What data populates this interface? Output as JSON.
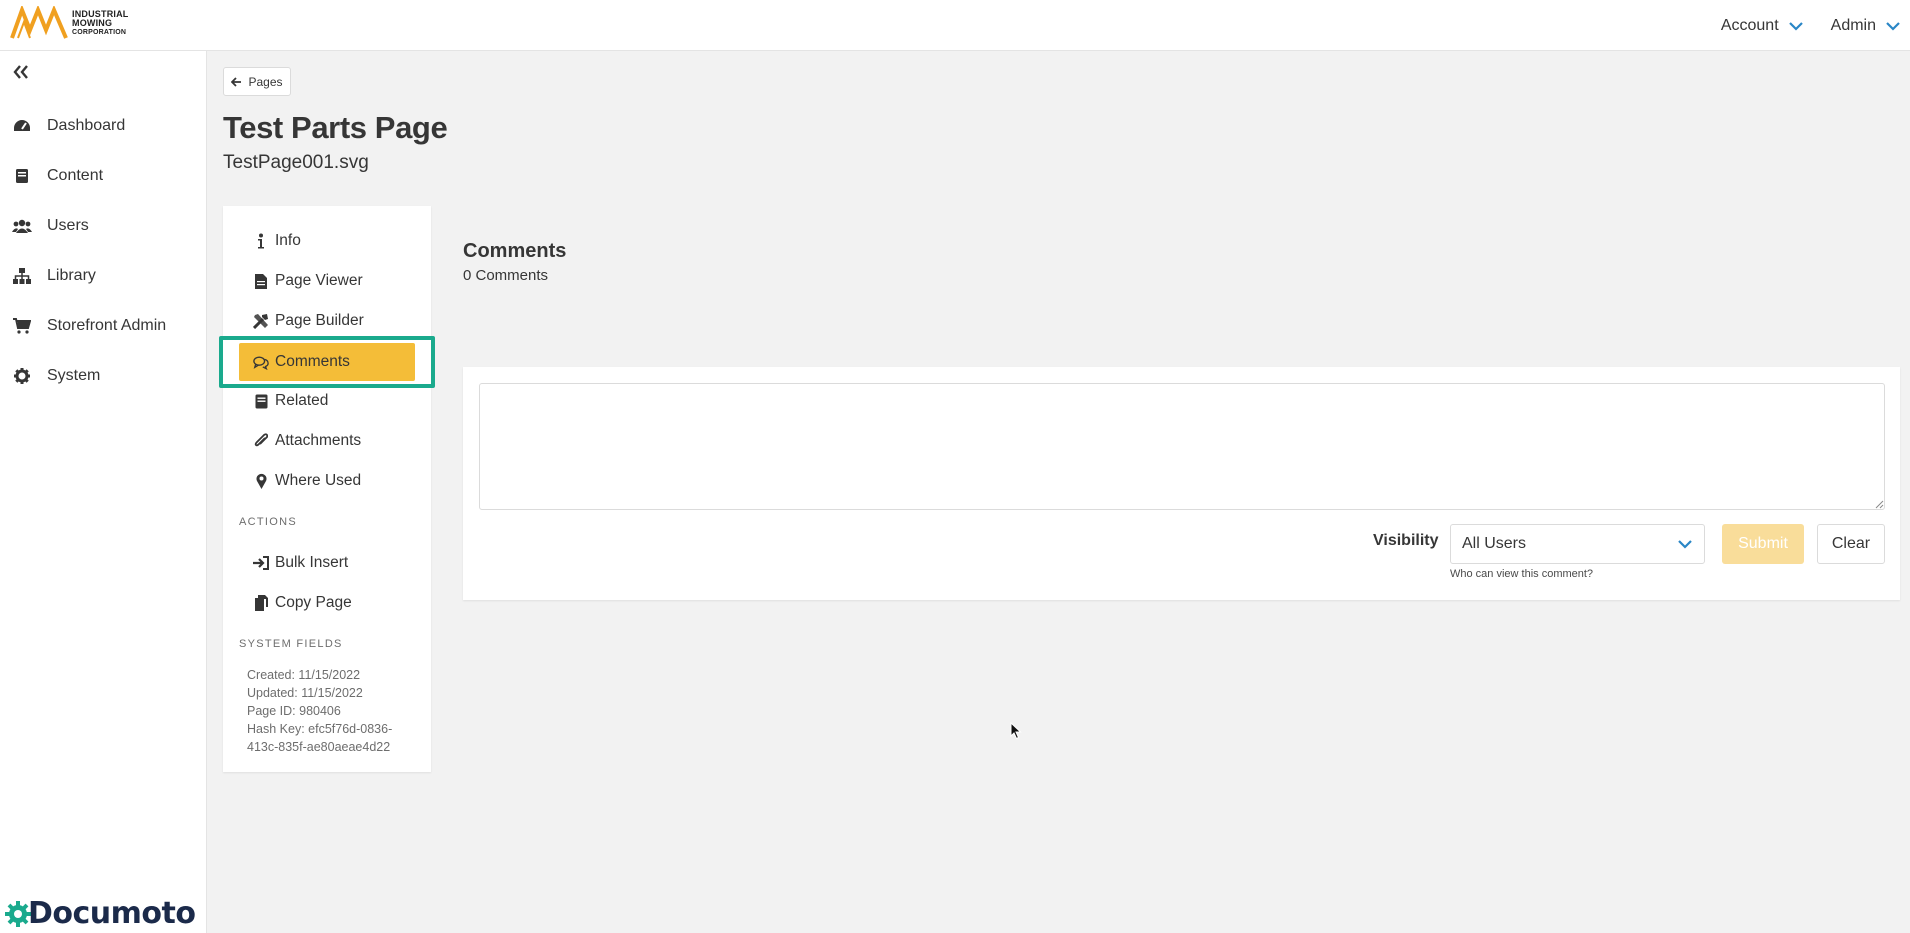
{
  "brand": {
    "line1": "INDUSTRIAL",
    "line2": "MOWING",
    "line3": "CORPORATION",
    "accent": "#f0a020"
  },
  "top_menu": {
    "account": "Account",
    "admin": "Admin"
  },
  "sidebar": {
    "items": [
      {
        "label": "Dashboard",
        "icon": "dashboard-icon"
      },
      {
        "label": "Content",
        "icon": "book-icon"
      },
      {
        "label": "Users",
        "icon": "users-icon"
      },
      {
        "label": "Library",
        "icon": "sitemap-icon"
      },
      {
        "label": "Storefront Admin",
        "icon": "cart-icon"
      },
      {
        "label": "System",
        "icon": "gear-icon"
      }
    ],
    "footer_logo": "Documoto"
  },
  "back_button": "Pages",
  "page": {
    "title": "Test Parts Page",
    "subtitle": "TestPage001.svg"
  },
  "sub_nav": {
    "items": [
      {
        "label": "Info",
        "icon": "info-icon"
      },
      {
        "label": "Page Viewer",
        "icon": "file-icon"
      },
      {
        "label": "Page Builder",
        "icon": "tools-icon"
      },
      {
        "label": "Comments",
        "icon": "comments-icon",
        "active": true
      },
      {
        "label": "Related",
        "icon": "book-icon"
      },
      {
        "label": "Attachments",
        "icon": "paperclip-icon"
      },
      {
        "label": "Where Used",
        "icon": "map-marker-icon"
      }
    ],
    "actions_label": "ACTIONS",
    "actions": [
      {
        "label": "Bulk Insert",
        "icon": "sign-in-icon"
      },
      {
        "label": "Copy Page",
        "icon": "copy-icon"
      }
    ],
    "system_fields_label": "SYSTEM FIELDS",
    "system_fields": {
      "created": "Created: 11/15/2022",
      "updated": "Updated: 11/15/2022",
      "page_id": "Page ID: 980406",
      "hash_key": "Hash Key: efc5f76d-0836-413c-835f-ae80aeae4d22"
    }
  },
  "comments": {
    "heading": "Comments",
    "count": "0 Comments",
    "textarea_value": "",
    "visibility_label": "Visibility",
    "visibility_selected": "All Users",
    "visibility_help": "Who can view this comment?",
    "submit": "Submit",
    "clear": "Clear"
  },
  "colors": {
    "active_bg": "#f4bd38",
    "active_outline": "#1aaa8d",
    "chevron": "#2a86c6",
    "submit_disabled": "#f9dd9a"
  }
}
